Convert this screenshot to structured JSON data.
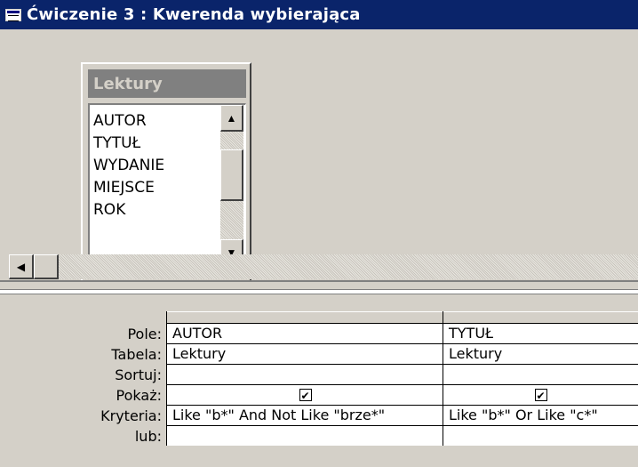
{
  "window": {
    "title": "Ćwiczenie 3 : Kwerenda wybierająca"
  },
  "table": {
    "name": "Lektury",
    "fields": [
      "AUTOR",
      "TYTUŁ",
      "WYDANIE",
      "MIEJSCE",
      "ROK"
    ]
  },
  "grid": {
    "row_labels": {
      "field": "Pole:",
      "table": "Tabela:",
      "sort": "Sortuj:",
      "show": "Pokaż:",
      "criteria": "Kryteria:",
      "or": "lub:"
    },
    "columns": [
      {
        "field": "AUTOR",
        "table": "Lektury",
        "sort": "",
        "show": true,
        "criteria": "Like \"b*\" And Not Like \"brze*\"",
        "or": ""
      },
      {
        "field": "TYTUŁ",
        "table": "Lektury",
        "sort": "",
        "show": true,
        "criteria": "Like \"b*\" Or Like \"c*\"",
        "or": ""
      }
    ]
  },
  "icons": {
    "window": "query-window-icon",
    "scroll_up": "up-arrow-icon",
    "scroll_down": "down-arrow-icon",
    "scroll_left": "left-arrow-icon",
    "checkmark": "check-icon"
  },
  "colors": {
    "title_bar": "#0a246a",
    "face": "#d4d0c8",
    "table_title": "#808080"
  }
}
